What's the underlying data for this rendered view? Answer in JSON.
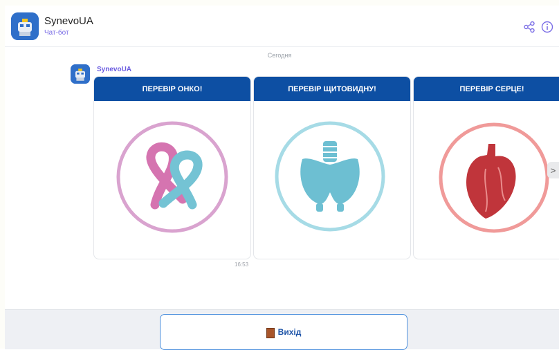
{
  "header": {
    "bot_name": "SynevoUA",
    "subtitle": "Чат-бот"
  },
  "icons": {
    "share": "share-icon",
    "info": "info-icon",
    "next": "chevron-right-icon",
    "exit": "door-icon"
  },
  "chat": {
    "date_separator": "Сегодня",
    "sender": "SynevoUA",
    "time": "16:53",
    "cards": [
      {
        "title": "ПЕРЕВІР ОНКО!",
        "image": "cancer-ribbons-icon"
      },
      {
        "title": "ПЕРЕВІР ЩИТОВИДНУ!",
        "image": "thyroid-icon"
      },
      {
        "title": "ПЕРЕВІР СЕРЦЕ!",
        "image": "heart-icon"
      }
    ],
    "next_arrow": ">"
  },
  "footer": {
    "exit_label": "Вихід"
  },
  "colors": {
    "brand_blue": "#0d4fa3",
    "accent_purple": "#7b6ee6",
    "exit_border": "#4d90dd"
  }
}
